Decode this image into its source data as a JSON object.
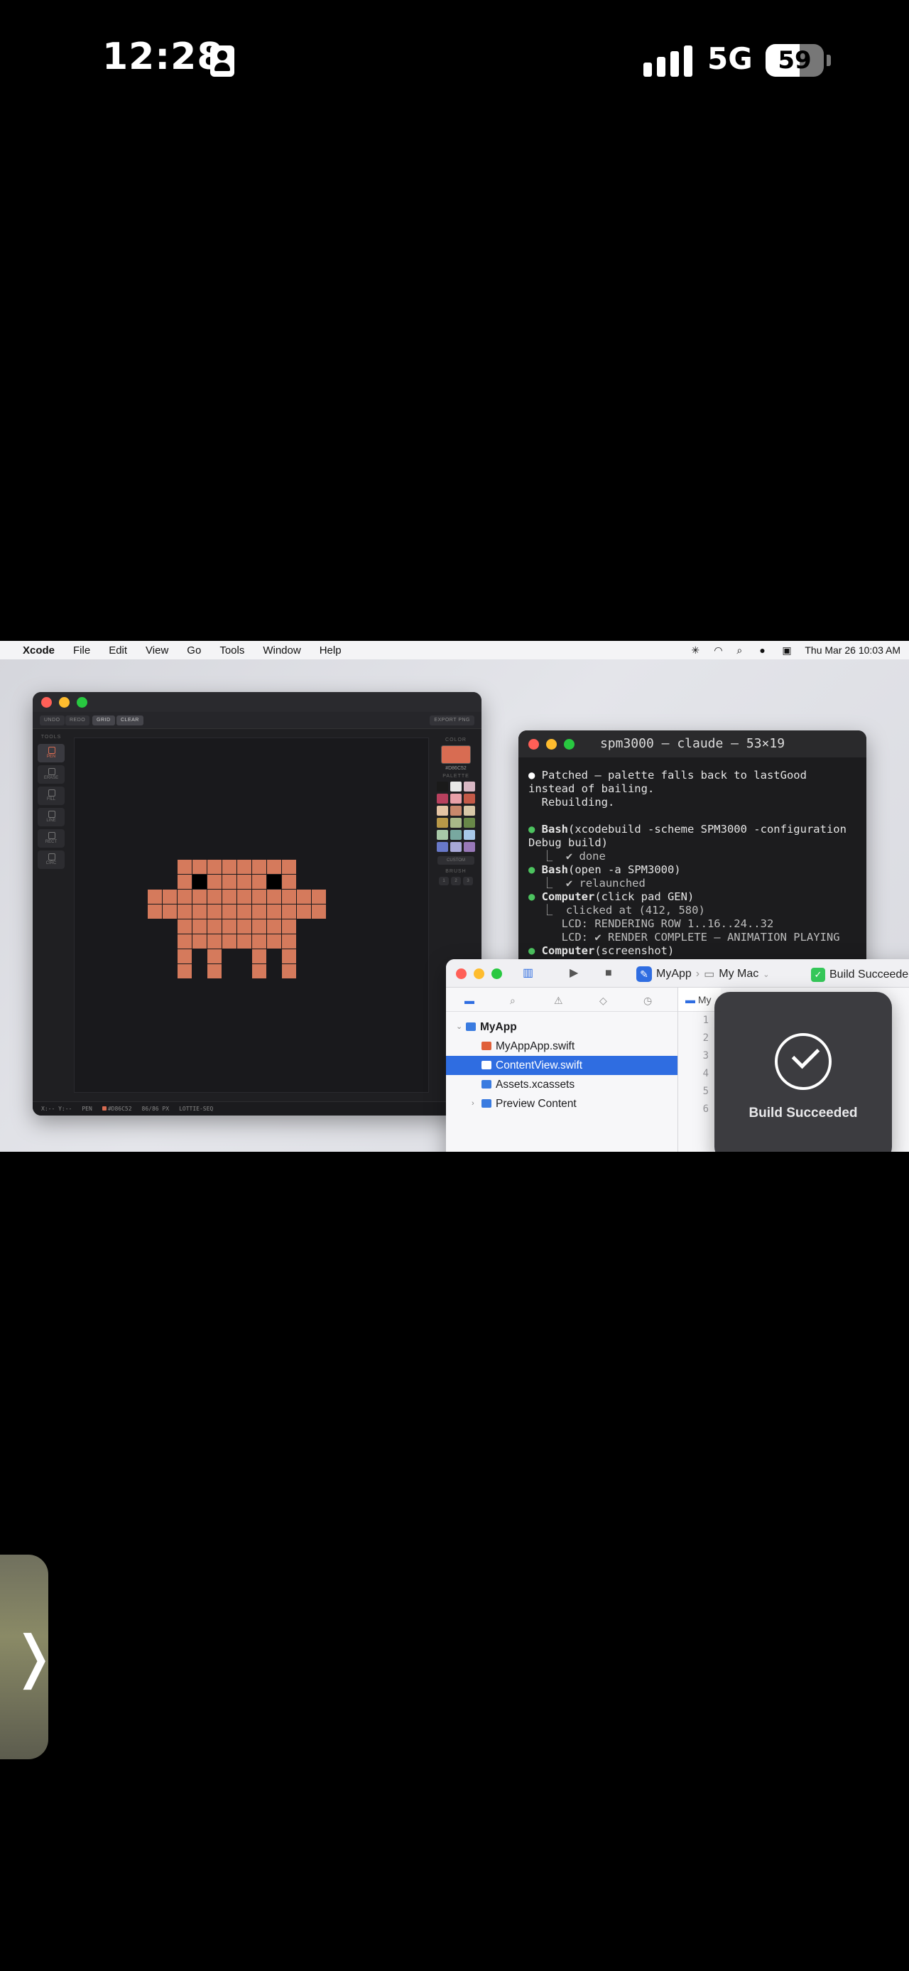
{
  "status_bar": {
    "time": "12:28",
    "network": "5G",
    "battery": "59",
    "battery_level": 0.59
  },
  "menubar": {
    "app": "Xcode",
    "items": [
      "File",
      "Edit",
      "View",
      "Go",
      "Tools",
      "Window",
      "Help"
    ],
    "datetime": "Thu Mar 26  10:03 AM"
  },
  "pixel_editor": {
    "toolbar": {
      "left_buttons": [
        "UNDO",
        "REDO",
        "GRID",
        "CLEAR"
      ],
      "export": "EXPORT PNG"
    },
    "tools_heading": "TOOLS",
    "tools": [
      "PEN",
      "ERASE",
      "FILL",
      "LINE",
      "RECT",
      "CIRC"
    ],
    "color_heading": "COLOR",
    "current_color": "#D86C52",
    "current_hex": "#D86C52",
    "palette_heading": "PALETTE",
    "palette": [
      "#1a1a1a",
      "#e8e8e8",
      "#d9b8c4",
      "#b8405e",
      "#e8a0a8",
      "#c45a48",
      "#e4c4a4",
      "#c8886c",
      "#d8c8a8",
      "#b89848",
      "#a8b888",
      "#688848",
      "#a8c8a8",
      "#78a8a0",
      "#a8c8e8",
      "#6878c8",
      "#a8a8d8",
      "#9878b8"
    ],
    "custom_button": "CUSTOM",
    "brush_heading": "BRUSH",
    "brush_sizes": [
      "1",
      "2",
      "3"
    ],
    "status": {
      "coords": "X:-- Y:--",
      "tool": "PEN",
      "color": "#D86C52",
      "size": "86/86 PX",
      "mode": "LOTTIE-SEQ"
    },
    "sprite_color": "#d57a5c",
    "eye_color": "#000000"
  },
  "terminal": {
    "title": "spm3000 — claude — 53×19",
    "lines": [
      {
        "bullet": "white",
        "text": "Patched — palette falls back to lastGood"
      },
      {
        "text": "instead of bailing."
      },
      {
        "text": "  Rebuilding."
      },
      {
        "text": ""
      },
      {
        "bullet": "green",
        "bold": "Bash",
        "text": "(xcodebuild -scheme SPM3000 -configuration"
      },
      {
        "text": "Debug build)"
      },
      {
        "text": "  ⎿  ✔ done",
        "dim": true
      },
      {
        "bullet": "green",
        "bold": "Bash",
        "text": "(open -a SPM3000)"
      },
      {
        "text": "  ⎿  ✔ relaunched",
        "dim": true
      },
      {
        "bullet": "green",
        "bold": "Computer",
        "text": "(click pad GEN)"
      },
      {
        "text": "  ⎿  clicked at (412, 580)",
        "dim": true
      },
      {
        "text": "     LCD: RENDERING ROW 1..16..24..32",
        "dim": true
      },
      {
        "text": "     LCD: ✔ RENDER COMPLETE — ANIMATION PLAYING",
        "dim": true
      },
      {
        "bullet": "green",
        "bold": "Computer",
        "text": "(screenshot)"
      }
    ]
  },
  "xcode": {
    "scheme": "MyApp",
    "destination": "My Mac",
    "build_status": "Build Succeeded",
    "editor_tab": "My",
    "navigator": [
      {
        "label": "MyApp",
        "type": "folder",
        "level": 0,
        "bold": true
      },
      {
        "label": "MyAppApp.swift",
        "type": "swift",
        "level": 1
      },
      {
        "label": "ContentView.swift",
        "type": "swift",
        "level": 1,
        "selected": true
      },
      {
        "label": "Assets.xcassets",
        "type": "assets",
        "level": 1
      },
      {
        "label": "Preview Content",
        "type": "folder",
        "level": 1
      }
    ],
    "line_numbers": [
      "1",
      "2",
      "3",
      "4",
      "5",
      "6"
    ],
    "hud_label": "Build Succeeded"
  }
}
